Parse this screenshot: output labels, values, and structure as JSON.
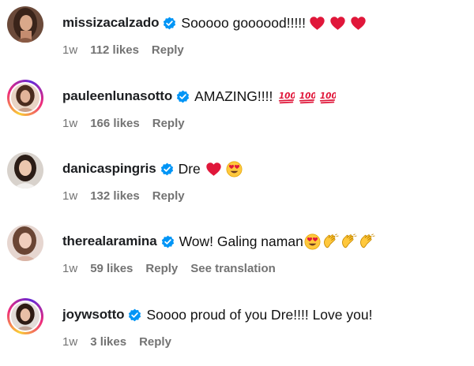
{
  "comments": [
    {
      "username": "missizacalzado",
      "verified_icon": "verified-badge-icon",
      "text": "Sooooo goooood!!!!!",
      "emojis": [
        "red-heart-icon",
        "red-heart-icon",
        "red-heart-icon"
      ],
      "time": "1w",
      "likes": "112 likes",
      "reply": "Reply"
    },
    {
      "username": "pauleenlunasotto",
      "verified_icon": "verified-badge-icon",
      "text": "AMAZING!!!!",
      "emojis": [
        "hundred-points-icon",
        "hundred-points-icon",
        "hundred-points-icon"
      ],
      "time": "1w",
      "likes": "166 likes",
      "reply": "Reply"
    },
    {
      "username": "danicaspingris",
      "verified_icon": "verified-badge-icon",
      "text": "Dre",
      "emojis": [
        "red-heart-icon",
        "heart-eyes-icon"
      ],
      "time": "1w",
      "likes": "132 likes",
      "reply": "Reply"
    },
    {
      "username": "therealaramina",
      "verified_icon": "verified-badge-icon",
      "text": "Wow! Galing naman",
      "emojis": [
        "heart-eyes-icon",
        "clapping-hands-icon",
        "clapping-hands-icon",
        "clapping-hands-icon"
      ],
      "time": "1w",
      "likes": "59 likes",
      "reply": "Reply",
      "translate": "See translation"
    },
    {
      "username": "joywsotto",
      "verified_icon": "verified-badge-icon",
      "text": "Soooo proud of you Dre!!!! Love you!",
      "emojis": [],
      "time": "1w",
      "likes": "3 likes",
      "reply": "Reply"
    }
  ],
  "colors": {
    "verified_blue": "#0095f6",
    "meta_gray": "#737373",
    "heart_red": "#e0173a",
    "story_ring": "#ee2a7b"
  }
}
